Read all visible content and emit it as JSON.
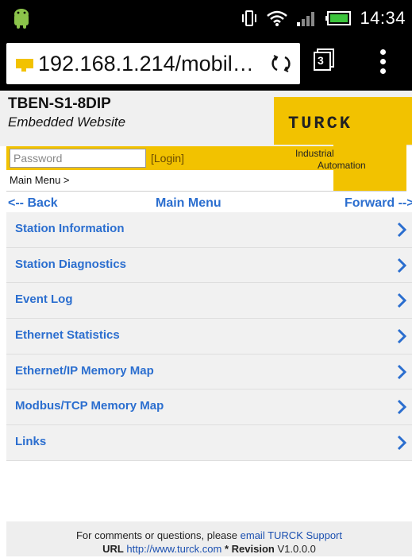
{
  "status_bar": {
    "time": "14:34",
    "icons": [
      "android-icon",
      "vibrate-icon",
      "wifi-icon",
      "signal-icon",
      "battery-icon"
    ]
  },
  "browser": {
    "url": "192.168.1.214/mobil…",
    "tab_count": "3",
    "icons": [
      "favicon-icon",
      "reload-icon",
      "tabs-icon",
      "overflow-menu-icon"
    ]
  },
  "site": {
    "device_name": "TBEN-S1-8DIP",
    "device_subtitle": "Embedded Website",
    "logo_text": "TURCK",
    "tagline_line1": "Industrial",
    "tagline_line2": "Automation",
    "brand_color": "#f2c200"
  },
  "login": {
    "password_placeholder": "Password",
    "login_label": "[Login]"
  },
  "breadcrumb": "Main Menu >",
  "nav": {
    "back": "<-- Back",
    "title": "Main Menu",
    "forward": "Forward -->"
  },
  "menu": {
    "items": [
      {
        "label": "Station Information"
      },
      {
        "label": "Station Diagnostics"
      },
      {
        "label": "Event Log"
      },
      {
        "label": "Ethernet Statistics"
      },
      {
        "label": "Ethernet/IP Memory Map"
      },
      {
        "label": "Modbus/TCP Memory Map"
      },
      {
        "label": "Links"
      }
    ],
    "link_color": "#2b6ecf"
  },
  "footer": {
    "line1_text": "For comments or questions, please ",
    "line1_link": "email TURCK Support",
    "url_label": "URL",
    "url_value": "http://www.turck.com",
    "separator": "*",
    "revision_label": "Revision",
    "revision_value": "V1.0.0.0"
  }
}
